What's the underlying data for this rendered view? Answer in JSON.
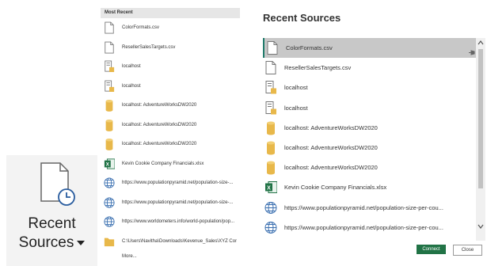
{
  "ribbon": {
    "line1": "Recent",
    "line2": "Sources"
  },
  "menu": {
    "header": "Most Recent",
    "items": [
      {
        "label": "ColorFormats.csv",
        "icon": "file"
      },
      {
        "label": "ResellerSalesTargets.csv",
        "icon": "file"
      },
      {
        "label": "localhost",
        "icon": "server"
      },
      {
        "label": "localhost",
        "icon": "server"
      },
      {
        "label": "localhost: AdventureWorksDW2020",
        "icon": "database"
      },
      {
        "label": "localhost: AdventureWorksDW2020",
        "icon": "database"
      },
      {
        "label": "localhost: AdventureWorksDW2020",
        "icon": "database"
      },
      {
        "label": "Kevin Cookie Company Financials.xlsx",
        "icon": "excel"
      },
      {
        "label": "https://www.populationpyramid.net/population-size-...",
        "icon": "globe"
      },
      {
        "label": "https://www.populationpyramid.net/population-size-...",
        "icon": "globe"
      },
      {
        "label": "https://www.worldometers.info/world-population/pop...",
        "icon": "globe"
      },
      {
        "label": "C:\\Users\\Navitha\\Downloads\\Kevenue_Sales\\XYZ Compa...",
        "icon": "folder"
      }
    ],
    "more": "More..."
  },
  "dialog": {
    "title": "Recent Sources",
    "items": [
      {
        "label": "ColorFormats.csv",
        "icon": "file",
        "selected": true
      },
      {
        "label": "ResellerSalesTargets.csv",
        "icon": "file",
        "selected": false
      },
      {
        "label": "localhost",
        "icon": "server",
        "selected": false
      },
      {
        "label": "localhost",
        "icon": "server",
        "selected": false
      },
      {
        "label": "localhost: AdventureWorksDW2020",
        "icon": "database",
        "selected": false
      },
      {
        "label": "localhost: AdventureWorksDW2020",
        "icon": "database",
        "selected": false
      },
      {
        "label": "localhost: AdventureWorksDW2020",
        "icon": "database",
        "selected": false
      },
      {
        "label": "Kevin Cookie Company Financials.xlsx",
        "icon": "excel",
        "selected": false
      },
      {
        "label": "https://www.populationpyramid.net/population-size-per-cou...",
        "icon": "globe",
        "selected": false
      },
      {
        "label": "https://www.populationpyramid.net/population-size-per-cou...",
        "icon": "globe",
        "selected": false
      }
    ],
    "connect": "Connect",
    "close": "Close"
  },
  "colors": {
    "accent": "#217346",
    "selected": "#c8c8c8",
    "db": "#e8b84a",
    "globe": "#3a6fb0"
  }
}
